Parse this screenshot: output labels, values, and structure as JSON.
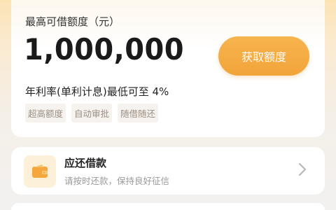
{
  "loan_card": {
    "title": "最高可借额度（元）",
    "amount": "1,000,000",
    "button_label": "获取额度",
    "rate_text": "年利率(单利计息)最低可至 4%",
    "tags": [
      "超高额度",
      "自动审批",
      "随借随还"
    ]
  },
  "repay_card": {
    "icon": "wallet-icon",
    "title": "应还借款",
    "subtitle": "请按时还款，保持良好征信",
    "chevron": "chevron-right-icon"
  },
  "colors": {
    "accent": "#f2a43a",
    "tag_bg": "#f6f3ef",
    "tag_text": "#9a8f84"
  }
}
